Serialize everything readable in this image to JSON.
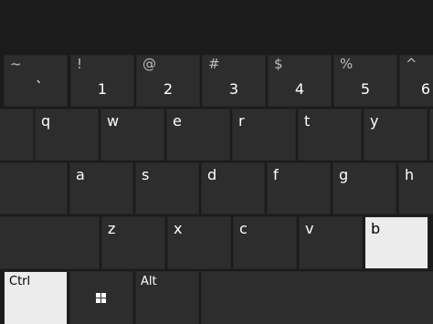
{
  "keyboard": {
    "number_row": [
      {
        "shift": "~",
        "main": "`"
      },
      {
        "shift": "!",
        "main": "1"
      },
      {
        "shift": "@",
        "main": "2"
      },
      {
        "shift": "#",
        "main": "3"
      },
      {
        "shift": "$",
        "main": "4"
      },
      {
        "shift": "%",
        "main": "5"
      },
      {
        "shift": "^",
        "main": "6"
      }
    ],
    "row_q": [
      "q",
      "w",
      "e",
      "r",
      "t",
      "y"
    ],
    "row_a": [
      "a",
      "s",
      "d",
      "f",
      "g",
      "h"
    ],
    "row_z": [
      "z",
      "x",
      "c",
      "v",
      "b"
    ],
    "bottom": {
      "ctrl": "Ctrl",
      "win": "windows-logo-icon",
      "alt": "Alt"
    },
    "pressed_keys": [
      "b",
      "Ctrl"
    ],
    "colors": {
      "background": "#1b1b1b",
      "key": "#2d2d2d",
      "key_pressed": "#ececec",
      "text": "#ffffff"
    }
  }
}
